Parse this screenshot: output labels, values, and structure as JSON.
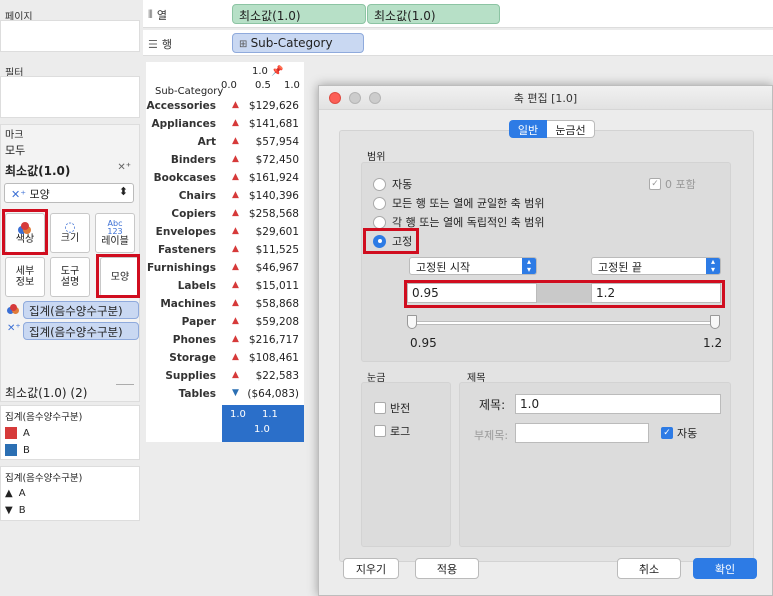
{
  "left": {
    "pages_label": "페이지",
    "filters_label": "필터",
    "marks_label": "마크",
    "all_label": "모두",
    "measure_title": "최소값(1.0)",
    "mark_type": "모양",
    "buttons": {
      "color": "색상",
      "size": "크기",
      "label": "레이블",
      "label_icon": "Abc\n123",
      "detail": "세부\n정보",
      "tooltip": "도구\n설명",
      "shape": "모양"
    },
    "pills": [
      "집계(음수양수구분)",
      "집계(음수양수구분)"
    ],
    "measure2": "최소값(1.0) (2)",
    "legend1_title": "집계(음수양수구분)",
    "legend1_items": [
      "A",
      "B"
    ],
    "legend2_title": "집계(음수양수구분)",
    "legend2_items": [
      "A",
      "B"
    ]
  },
  "shelves": {
    "cols_label": "열",
    "rows_label": "행",
    "col_pills": [
      "최소값(1.0)",
      "최소값(1.0)"
    ],
    "row_pill": "Sub-Category"
  },
  "table": {
    "header": "Sub-Category",
    "axis_top": "1.0",
    "axis_ticks": [
      "0.0",
      "0.5",
      "1.0"
    ],
    "rows": [
      {
        "cat": "Accessories",
        "dir": "up",
        "val": "$129,626"
      },
      {
        "cat": "Appliances",
        "dir": "up",
        "val": "$141,681"
      },
      {
        "cat": "Art",
        "dir": "up",
        "val": "$57,954"
      },
      {
        "cat": "Binders",
        "dir": "up",
        "val": "$72,450"
      },
      {
        "cat": "Bookcases",
        "dir": "up",
        "val": "$161,924"
      },
      {
        "cat": "Chairs",
        "dir": "up",
        "val": "$140,396"
      },
      {
        "cat": "Copiers",
        "dir": "up",
        "val": "$258,568"
      },
      {
        "cat": "Envelopes",
        "dir": "up",
        "val": "$29,601"
      },
      {
        "cat": "Fasteners",
        "dir": "up",
        "val": "$11,525"
      },
      {
        "cat": "Furnishings",
        "dir": "up",
        "val": "$46,967"
      },
      {
        "cat": "Labels",
        "dir": "up",
        "val": "$15,011"
      },
      {
        "cat": "Machines",
        "dir": "up",
        "val": "$58,868"
      },
      {
        "cat": "Paper",
        "dir": "up",
        "val": "$59,208"
      },
      {
        "cat": "Phones",
        "dir": "up",
        "val": "$216,717"
      },
      {
        "cat": "Storage",
        "dir": "up",
        "val": "$108,461"
      },
      {
        "cat": "Supplies",
        "dir": "up",
        "val": "$22,583"
      },
      {
        "cat": "Tables",
        "dir": "down",
        "val": "($64,083)"
      }
    ],
    "bottom_labels": [
      "1.0",
      "1.1",
      "1.0"
    ]
  },
  "dialog": {
    "title": "축 편집 [1.0]",
    "tabs": [
      "일반",
      "눈금선"
    ],
    "range_label": "범위",
    "options": [
      "자동",
      "모든 행 또는 열에 균일한 축 범위",
      "각 행 또는 열에 독립적인 축 범위",
      "고정"
    ],
    "include_zero": "0 포함",
    "fixed_start": "고정된 시작",
    "fixed_end": "고정된 끝",
    "start_value": "0.95",
    "end_value": "1.2",
    "slider_min": "0.95",
    "slider_max": "1.2",
    "ticks_label": "눈금",
    "reverse": "반전",
    "log": "로그",
    "title_section": "제목",
    "title_field_label": "제목:",
    "title_value": "1.0",
    "subtitle_label": "부제목:",
    "subtitle_value": "",
    "auto_label": "자동",
    "clear_btn": "지우기",
    "apply_btn": "적용",
    "cancel_btn": "취소",
    "ok_btn": "확인"
  },
  "colors": {
    "legend_a": "#d63a3a",
    "legend_b": "#2b6fb3",
    "accent": "#2d7be5",
    "highlight": "#d00d1f"
  }
}
